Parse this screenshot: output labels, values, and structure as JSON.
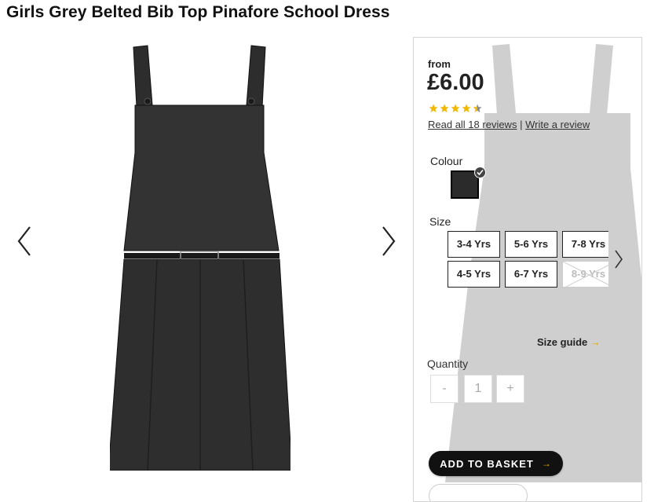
{
  "product": {
    "title": "Girls Grey Belted Bib Top Pinafore School Dress"
  },
  "gallery": {
    "prev_icon": "chevron-left-icon",
    "next_icon": "chevron-right-icon"
  },
  "pricing": {
    "from_label": "from",
    "price": "£6.00"
  },
  "rating": {
    "value": 4.5,
    "max": 5,
    "star_color": "#f2b800",
    "read_reviews": "Read all 18 reviews",
    "separator": "|",
    "write_review": "Write a review"
  },
  "colour": {
    "label": "Colour",
    "selected": "#2b2b2b"
  },
  "size": {
    "label": "Size",
    "options": [
      {
        "label": "3-4 Yrs",
        "available": true
      },
      {
        "label": "5-6 Yrs",
        "available": true
      },
      {
        "label": "7-8 Yrs",
        "available": true
      },
      {
        "label": "4-5 Yrs",
        "available": true
      },
      {
        "label": "6-7 Yrs",
        "available": true
      },
      {
        "label": "8-9 Yrs",
        "available": false
      }
    ],
    "guide": "Size guide",
    "guide_arrow": "→"
  },
  "quantity": {
    "label": "Quantity",
    "minus": "-",
    "value": "1",
    "plus": "+"
  },
  "basket": {
    "label": "ADD TO BASKET",
    "arrow": "→"
  }
}
